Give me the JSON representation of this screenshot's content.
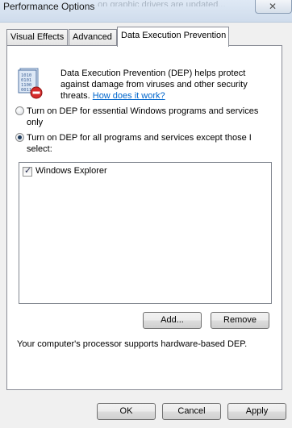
{
  "window": {
    "title": "Performance Options",
    "faded_title": "...on graphic drivers are updated..."
  },
  "tabs": [
    {
      "label": "Visual Effects",
      "active": false
    },
    {
      "label": "Advanced",
      "active": false
    },
    {
      "label": "Data Execution Prevention",
      "active": true
    }
  ],
  "dep": {
    "intro_text": "Data Execution Prevention (DEP) helps protect against damage from viruses and other security threats.",
    "link_text": "How does it work?",
    "options": [
      {
        "label": "Turn on DEP for essential Windows programs and services only",
        "selected": false
      },
      {
        "label": "Turn on DEP for all programs and services except those I select:",
        "selected": true
      }
    ],
    "exceptions": [
      {
        "label": "Windows Explorer",
        "checked": true
      }
    ],
    "add_label": "Add...",
    "remove_label": "Remove",
    "support_text": "Your computer's processor supports hardware-based DEP."
  },
  "footer": {
    "ok_label": "OK",
    "cancel_label": "Cancel",
    "apply_label": "Apply"
  },
  "colors": {
    "link": "#0066cc",
    "panel_bg": "#ffffff",
    "dialog_bg": "#f0f0f0"
  }
}
